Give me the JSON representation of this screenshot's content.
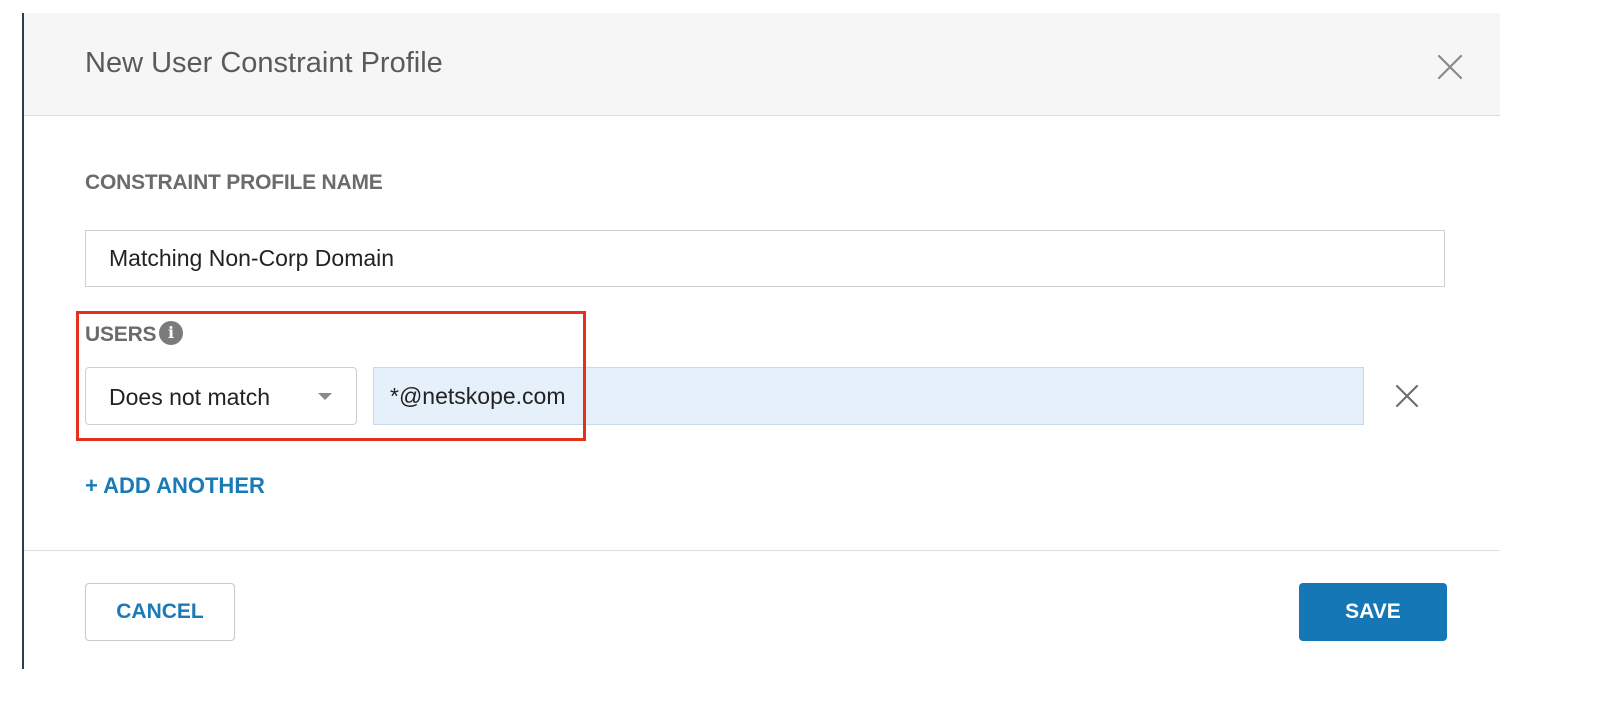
{
  "modal": {
    "title": "New User Constraint Profile"
  },
  "profile_name": {
    "label": "CONSTRAINT PROFILE NAME",
    "value": "Matching Non-Corp Domain"
  },
  "users": {
    "label": "USERS",
    "info_glyph": "i",
    "rules": [
      {
        "operator": "Does not match",
        "value": "*@netskope.com"
      }
    ],
    "add_another_label": "+ ADD ANOTHER"
  },
  "footer": {
    "cancel_label": "CANCEL",
    "save_label": "SAVE"
  },
  "colors": {
    "accent": "#1a7ab8",
    "primary_button": "#1577b5",
    "highlight": "#e5311c",
    "input_highlight_bg": "#e6f0fb"
  },
  "icons": [
    "close-icon",
    "info-icon",
    "chevron-down-icon",
    "remove-row-icon"
  ]
}
